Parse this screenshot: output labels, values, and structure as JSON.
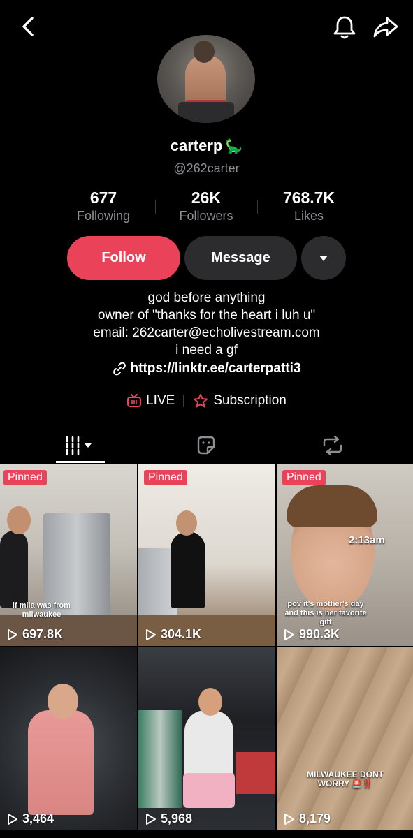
{
  "header": {
    "back_icon": "chevron-left-icon",
    "bell_icon": "bell-icon",
    "share_icon": "share-arrow-icon"
  },
  "profile": {
    "display_name": "carterp",
    "name_emoji": "🦕",
    "handle": "@262carter"
  },
  "stats": {
    "following": {
      "value": "677",
      "label": "Following"
    },
    "followers": {
      "value": "26K",
      "label": "Followers"
    },
    "likes": {
      "value": "768.7K",
      "label": "Likes"
    }
  },
  "actions": {
    "follow_label": "Follow",
    "message_label": "Message",
    "more_icon": "caret-down-icon"
  },
  "bio": {
    "lines": [
      "god before anything",
      "owner of \"thanks for the heart i luh u\"",
      "email: 262carter@echolivestream.com",
      "i need a gf"
    ],
    "link": "https://linktr.ee/carterpatti3"
  },
  "chips": {
    "live_label": "LIVE",
    "subscription_label": "Subscription"
  },
  "tabs": {
    "videos_icon": "grid-bars-icon",
    "favorites_icon": "sticker-icon",
    "reposts_icon": "repost-icon"
  },
  "colors": {
    "accent": "#ea4359",
    "button_dark": "#2c2c2e",
    "muted_text": "#8e8e93",
    "background": "#000000"
  },
  "videos": [
    {
      "pinned": "Pinned",
      "views": "697.8K",
      "caption": "if mila was from milwaukee"
    },
    {
      "pinned": "Pinned",
      "views": "304.1K",
      "caption": ""
    },
    {
      "pinned": "Pinned",
      "views": "990.3K",
      "caption": "pov it's mother's day and this is her favorite gift",
      "overlay": "2:13am"
    },
    {
      "pinned": "",
      "views": "3,464",
      "caption": ""
    },
    {
      "pinned": "",
      "views": "5,968",
      "caption": ""
    },
    {
      "pinned": "",
      "views": "8,179",
      "caption": "MILWAUKEE DONT WORRY",
      "caption_emoji": "🚨‼️"
    }
  ]
}
